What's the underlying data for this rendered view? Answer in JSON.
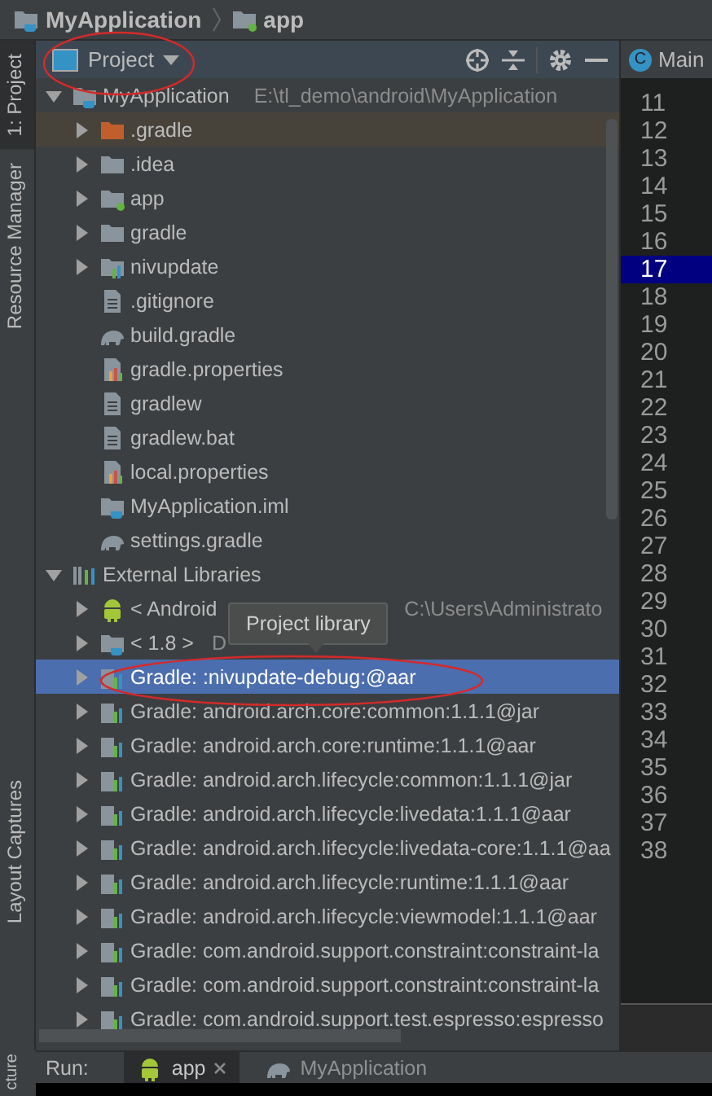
{
  "breadcrumb": [
    {
      "label": "MyApplication",
      "kind": "project"
    },
    {
      "label": "app",
      "kind": "module"
    }
  ],
  "tool_windows": {
    "top": [
      {
        "label": "1: Project",
        "selected": true
      },
      {
        "label": "Resource Manager",
        "selected": false
      }
    ],
    "bottom": [
      {
        "label": "Layout Captures",
        "selected": false
      }
    ],
    "corner": [
      {
        "label": "cture",
        "selected": false
      }
    ]
  },
  "project_panel": {
    "view": "Project",
    "tooltip": "Project library",
    "tree": [
      {
        "label": "MyApplication",
        "detail": "E:\\tl_demo\\android\\MyApplication",
        "kind": "project",
        "expanded": true,
        "selected": false,
        "children": [
          {
            "label": ".gradle",
            "kind": "excluded",
            "expanded": false,
            "selected": false
          },
          {
            "label": ".idea",
            "kind": "folder",
            "expanded": false,
            "selected": false
          },
          {
            "label": "app",
            "kind": "module",
            "expanded": false,
            "selected": false
          },
          {
            "label": "gradle",
            "kind": "folder",
            "expanded": false,
            "selected": false
          },
          {
            "label": "nivupdate",
            "kind": "libmodule",
            "expanded": false,
            "selected": false
          },
          {
            "label": ".gitignore",
            "kind": "text",
            "selected": false
          },
          {
            "label": "build.gradle",
            "kind": "gradle",
            "selected": false
          },
          {
            "label": "gradle.properties",
            "kind": "properties",
            "selected": false
          },
          {
            "label": "gradlew",
            "kind": "text",
            "selected": false
          },
          {
            "label": "gradlew.bat",
            "kind": "text",
            "selected": false
          },
          {
            "label": "local.properties",
            "kind": "properties",
            "selected": false
          },
          {
            "label": "MyApplication.iml",
            "kind": "iml",
            "selected": false
          },
          {
            "label": "settings.gradle",
            "kind": "gradle",
            "selected": false
          }
        ]
      },
      {
        "label": "External Libraries",
        "kind": "libraries",
        "expanded": true,
        "selected": false,
        "children": [
          {
            "label": "< Android",
            "detail": "C:\\Users\\Administrato",
            "kind": "android",
            "expanded": false,
            "selected": false
          },
          {
            "label": "< 1.8 >",
            "detail": "D",
            "kind": "jdk",
            "expanded": false,
            "selected": false
          },
          {
            "label": "Gradle: :nivupdate-debug:@aar",
            "kind": "library",
            "expanded": false,
            "selected": true
          },
          {
            "label": "Gradle: android.arch.core:common:1.1.1@jar",
            "kind": "library",
            "expanded": false,
            "selected": false
          },
          {
            "label": "Gradle: android.arch.core:runtime:1.1.1@aar",
            "kind": "library",
            "expanded": false,
            "selected": false
          },
          {
            "label": "Gradle: android.arch.lifecycle:common:1.1.1@jar",
            "kind": "library",
            "expanded": false,
            "selected": false
          },
          {
            "label": "Gradle: android.arch.lifecycle:livedata:1.1.1@aar",
            "kind": "library",
            "expanded": false,
            "selected": false
          },
          {
            "label": "Gradle: android.arch.lifecycle:livedata-core:1.1.1@aa",
            "kind": "library",
            "expanded": false,
            "selected": false
          },
          {
            "label": "Gradle: android.arch.lifecycle:runtime:1.1.1@aar",
            "kind": "library",
            "expanded": false,
            "selected": false
          },
          {
            "label": "Gradle: android.arch.lifecycle:viewmodel:1.1.1@aar",
            "kind": "library",
            "expanded": false,
            "selected": false
          },
          {
            "label": "Gradle: com.android.support.constraint:constraint-la",
            "kind": "library",
            "expanded": false,
            "selected": false
          },
          {
            "label": "Gradle: com.android.support.constraint:constraint-la",
            "kind": "library",
            "expanded": false,
            "selected": false
          },
          {
            "label": "Gradle: com.android.support.test.espresso:espresso",
            "kind": "library",
            "expanded": false,
            "selected": false
          }
        ]
      }
    ]
  },
  "editor": {
    "tab": {
      "badge": "C",
      "label": "Main",
      "selected": true
    },
    "lines": [
      {
        "number": "11",
        "current": false
      },
      {
        "number": "12",
        "current": false
      },
      {
        "number": "13",
        "current": false
      },
      {
        "number": "14",
        "current": false
      },
      {
        "number": "15",
        "current": false
      },
      {
        "number": "16",
        "current": false
      },
      {
        "number": "17",
        "current": true
      },
      {
        "number": "18",
        "current": false
      },
      {
        "number": "19",
        "current": false
      },
      {
        "number": "20",
        "current": false
      },
      {
        "number": "21",
        "current": false
      },
      {
        "number": "22",
        "current": false
      },
      {
        "number": "23",
        "current": false
      },
      {
        "number": "24",
        "current": false
      },
      {
        "number": "25",
        "current": false
      },
      {
        "number": "26",
        "current": false
      },
      {
        "number": "27",
        "current": false
      },
      {
        "number": "28",
        "current": false
      },
      {
        "number": "29",
        "current": false
      },
      {
        "number": "30",
        "current": false
      },
      {
        "number": "31",
        "current": false
      },
      {
        "number": "32",
        "current": false
      },
      {
        "number": "33",
        "current": false
      },
      {
        "number": "34",
        "current": false
      },
      {
        "number": "35",
        "current": false
      },
      {
        "number": "36",
        "current": false
      },
      {
        "number": "37",
        "current": false
      },
      {
        "number": "38",
        "current": false
      }
    ]
  },
  "run_bar": {
    "label": "Run:",
    "tabs": [
      {
        "label": "app",
        "kind": "android",
        "closable": true,
        "selected": true
      },
      {
        "label": "MyApplication",
        "kind": "gradle",
        "closable": false,
        "selected": false
      }
    ]
  }
}
